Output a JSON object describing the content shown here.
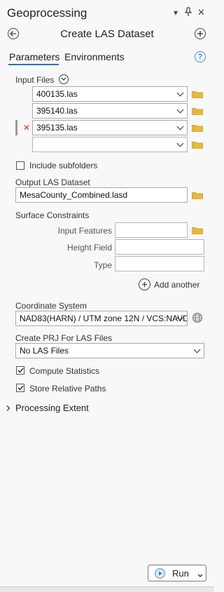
{
  "header": {
    "title": "Geoprocessing",
    "menu_glyph": "▾",
    "pin_glyph": "⊥",
    "close_glyph": "✕"
  },
  "tool": {
    "title": "Create LAS Dataset"
  },
  "tabs": [
    {
      "label": "Parameters",
      "active": true
    },
    {
      "label": "Environments",
      "active": false
    }
  ],
  "help_glyph": "?",
  "input_files": {
    "label": "Input Files",
    "files": [
      "400135.las",
      "395140.las",
      "395135.las",
      ""
    ],
    "remove_glyph": "✕"
  },
  "include_subfolders": {
    "label": "Include subfolders",
    "checked": false
  },
  "output": {
    "label": "Output LAS Dataset",
    "value": "MesaCounty_Combined.lasd"
  },
  "surface_constraints": {
    "label": "Surface Constraints",
    "input_features_label": "Input Features",
    "height_field_label": "Height Field",
    "type_label": "Type",
    "add_another_label": "Add another"
  },
  "coordinate_system": {
    "label": "Coordinate System",
    "value": "NAD83(HARN) / UTM zone 12N / VCS:NAVD"
  },
  "create_prj": {
    "label": "Create PRJ For LAS Files",
    "value": "No LAS Files"
  },
  "compute_statistics": {
    "label": "Compute Statistics",
    "checked": true
  },
  "store_relative_paths": {
    "label": "Store Relative Paths",
    "checked": true
  },
  "processing_extent": {
    "label": "Processing Extent"
  },
  "run": {
    "label": "Run"
  },
  "colors": {
    "accent": "#2b6fba",
    "folder": "#e8b93a",
    "remove": "#c8411b"
  }
}
